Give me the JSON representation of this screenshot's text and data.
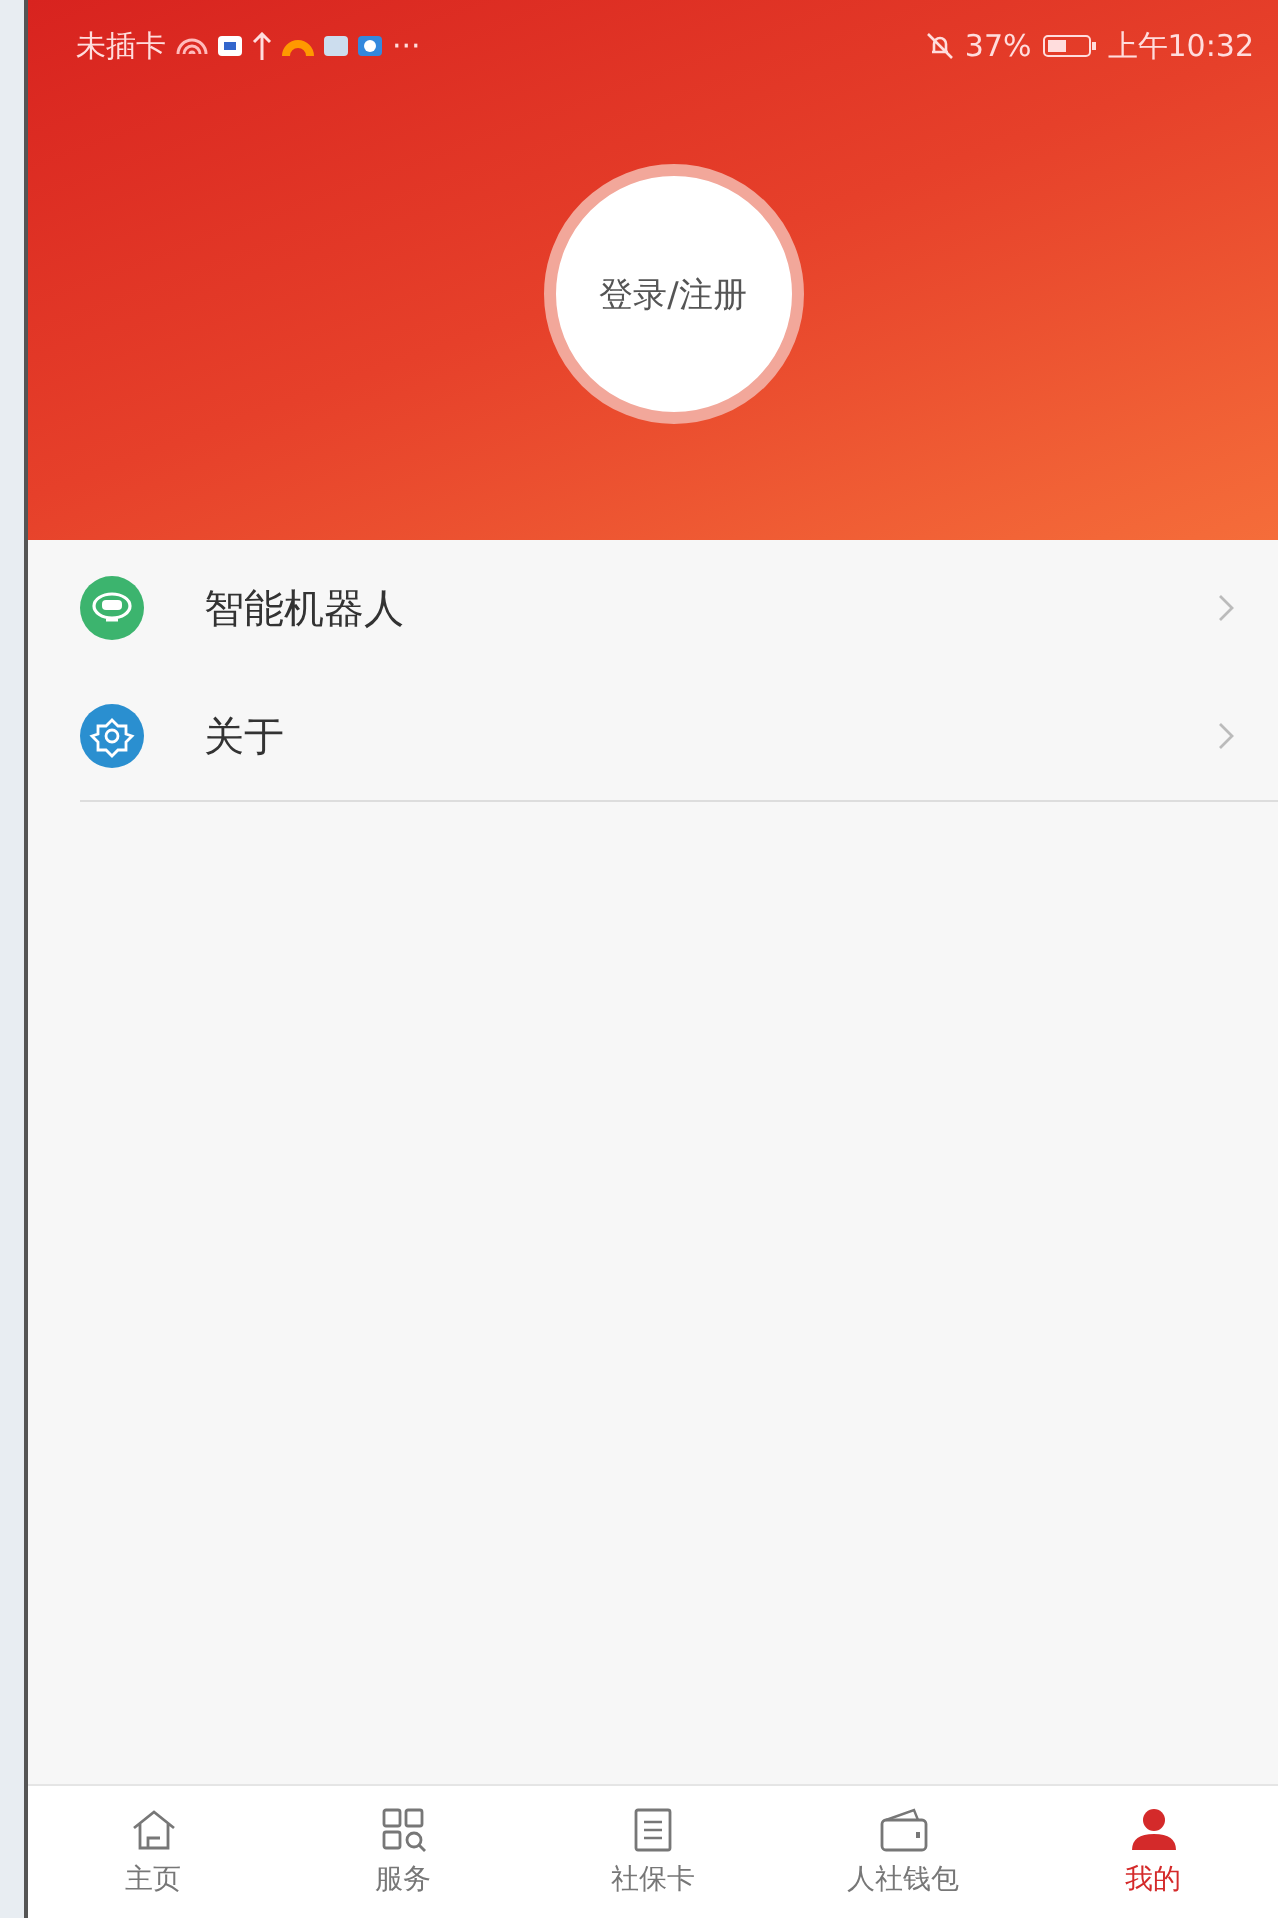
{
  "status_bar": {
    "carrier": "未插卡",
    "more": "···",
    "battery": "37%",
    "time": "上午10:32"
  },
  "header": {
    "login_button": "登录/注册"
  },
  "menu": [
    {
      "kind": "robot",
      "label": "智能机器人",
      "color": "#3cb46e"
    },
    {
      "kind": "about",
      "label": "关于",
      "color": "#2a8fd0"
    }
  ],
  "tabs": [
    {
      "kind": "home",
      "label": "主页",
      "selected": false
    },
    {
      "kind": "services",
      "label": "服务",
      "selected": false
    },
    {
      "kind": "card",
      "label": "社保卡",
      "selected": false
    },
    {
      "kind": "wallet",
      "label": "人社钱包",
      "selected": false
    },
    {
      "kind": "me",
      "label": "我的",
      "selected": true
    }
  ]
}
